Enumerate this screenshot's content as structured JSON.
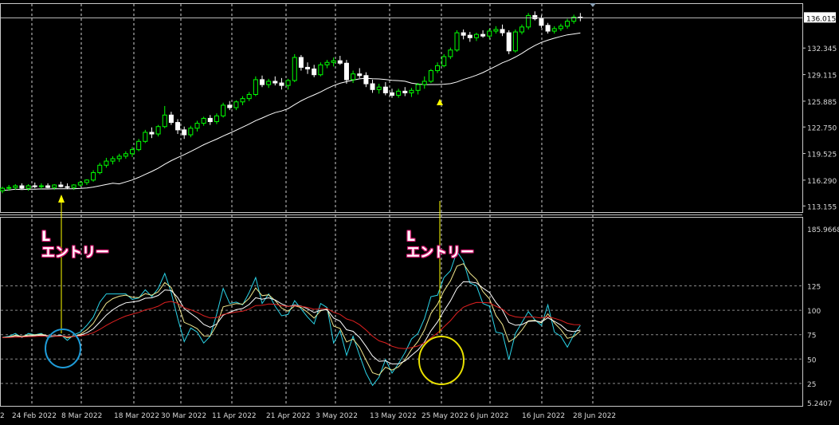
{
  "chart_data": {
    "type": "candlestick",
    "price_panel": {
      "y_ticks": [
        "132.345",
        "129.115",
        "125.885",
        "122.750",
        "119.525",
        "116.290",
        "113.155"
      ],
      "current_price_label": "136.015",
      "ylim": [
        112.6,
        137.6
      ],
      "candles": [
        [
          115.0,
          115.5,
          114.7,
          115.3
        ],
        [
          115.3,
          115.7,
          115.0,
          115.4
        ],
        [
          115.4,
          115.8,
          115.1,
          115.6
        ],
        [
          115.6,
          115.9,
          115.2,
          115.3
        ],
        [
          115.3,
          115.8,
          115.0,
          115.6
        ],
        [
          115.6,
          116.0,
          115.3,
          115.5
        ],
        [
          115.5,
          115.9,
          115.2,
          115.6
        ],
        [
          115.6,
          115.9,
          115.3,
          115.4
        ],
        [
          115.4,
          115.8,
          115.1,
          115.7
        ],
        [
          115.7,
          116.1,
          115.4,
          115.5
        ],
        [
          115.5,
          115.9,
          115.2,
          115.4
        ],
        [
          115.4,
          115.8,
          115.1,
          115.7
        ],
        [
          115.7,
          116.2,
          115.5,
          116.0
        ],
        [
          116.0,
          116.4,
          115.7,
          116.3
        ],
        [
          116.3,
          117.5,
          116.1,
          117.2
        ],
        [
          117.2,
          118.4,
          117.0,
          118.1
        ],
        [
          118.1,
          119.0,
          117.8,
          118.6
        ],
        [
          118.6,
          119.2,
          118.2,
          118.9
        ],
        [
          118.9,
          119.5,
          118.5,
          119.2
        ],
        [
          119.2,
          119.8,
          118.9,
          119.5
        ],
        [
          119.5,
          120.3,
          119.1,
          120.0
        ],
        [
          120.0,
          121.3,
          119.8,
          121.0
        ],
        [
          121.0,
          122.4,
          120.8,
          122.1
        ],
        [
          122.1,
          122.7,
          121.4,
          121.9
        ],
        [
          121.9,
          123.0,
          121.6,
          122.8
        ],
        [
          122.8,
          125.3,
          122.6,
          124.2
        ],
        [
          124.2,
          124.6,
          123.0,
          123.3
        ],
        [
          123.3,
          123.7,
          121.9,
          122.4
        ],
        [
          122.4,
          122.8,
          121.3,
          121.8
        ],
        [
          121.8,
          122.9,
          121.5,
          122.6
        ],
        [
          122.6,
          123.5,
          122.2,
          123.2
        ],
        [
          123.2,
          124.0,
          122.9,
          123.8
        ],
        [
          123.8,
          124.2,
          123.0,
          123.4
        ],
        [
          123.4,
          124.4,
          123.1,
          124.1
        ],
        [
          124.1,
          125.7,
          123.9,
          125.4
        ],
        [
          125.4,
          125.9,
          124.8,
          125.1
        ],
        [
          125.1,
          126.0,
          124.8,
          125.8
        ],
        [
          125.8,
          126.5,
          125.4,
          126.2
        ],
        [
          126.2,
          127.0,
          125.9,
          126.7
        ],
        [
          126.7,
          128.9,
          126.5,
          128.5
        ],
        [
          128.5,
          129.0,
          127.6,
          127.9
        ],
        [
          127.9,
          128.6,
          127.5,
          128.3
        ],
        [
          128.3,
          128.9,
          127.8,
          128.1
        ],
        [
          128.1,
          128.7,
          127.3,
          127.8
        ],
        [
          127.8,
          128.6,
          127.3,
          128.4
        ],
        [
          128.4,
          131.6,
          128.2,
          131.2
        ],
        [
          131.2,
          131.5,
          129.6,
          130.0
        ],
        [
          130.0,
          130.6,
          129.2,
          129.8
        ],
        [
          129.8,
          130.3,
          128.8,
          129.1
        ],
        [
          129.1,
          130.6,
          128.9,
          130.3
        ],
        [
          130.3,
          130.9,
          129.9,
          130.6
        ],
        [
          130.6,
          131.2,
          130.1,
          130.8
        ],
        [
          130.8,
          131.4,
          130.3,
          130.5
        ],
        [
          130.5,
          130.9,
          128.0,
          128.5
        ],
        [
          128.5,
          129.6,
          128.1,
          129.2
        ],
        [
          129.2,
          129.9,
          128.7,
          129.0
        ],
        [
          129.0,
          129.4,
          127.6,
          128.0
        ],
        [
          128.0,
          128.5,
          126.9,
          127.3
        ],
        [
          127.3,
          128.0,
          126.8,
          127.6
        ],
        [
          127.6,
          128.2,
          126.6,
          126.9
        ],
        [
          126.9,
          127.4,
          126.3,
          126.6
        ],
        [
          126.6,
          127.4,
          126.3,
          127.1
        ],
        [
          127.1,
          127.6,
          126.5,
          126.9
        ],
        [
          126.9,
          127.5,
          126.4,
          127.2
        ],
        [
          127.2,
          128.1,
          126.7,
          127.9
        ],
        [
          127.9,
          128.9,
          127.4,
          128.3
        ],
        [
          128.3,
          129.8,
          128.1,
          129.6
        ],
        [
          129.6,
          130.6,
          129.3,
          130.2
        ],
        [
          130.2,
          131.6,
          130.0,
          131.3
        ],
        [
          131.3,
          132.4,
          131.0,
          132.1
        ],
        [
          132.1,
          134.5,
          131.9,
          134.2
        ],
        [
          134.2,
          134.6,
          133.4,
          133.9
        ],
        [
          133.9,
          134.3,
          133.1,
          133.6
        ],
        [
          133.6,
          134.2,
          133.2,
          134.0
        ],
        [
          134.0,
          134.5,
          133.6,
          133.8
        ],
        [
          133.8,
          134.7,
          133.5,
          134.4
        ],
        [
          134.4,
          135.0,
          134.1,
          134.6
        ],
        [
          134.6,
          135.2,
          133.8,
          134.2
        ],
        [
          134.2,
          134.5,
          131.6,
          132.0
        ],
        [
          132.0,
          134.6,
          131.8,
          134.3
        ],
        [
          134.3,
          135.2,
          134.0,
          134.9
        ],
        [
          134.9,
          136.6,
          134.6,
          136.3
        ],
        [
          136.3,
          136.8,
          135.7,
          135.9
        ],
        [
          135.9,
          136.3,
          134.8,
          135.1
        ],
        [
          135.1,
          135.4,
          134.1,
          134.4
        ],
        [
          134.4,
          135.0,
          134.1,
          134.7
        ],
        [
          134.7,
          135.3,
          134.4,
          135.0
        ],
        [
          135.0,
          135.9,
          134.7,
          135.6
        ],
        [
          135.6,
          136.4,
          135.3,
          136.1
        ],
        [
          136.1,
          136.6,
          135.6,
          136.0
        ]
      ]
    },
    "oscillator_panel": {
      "y_ticks": [
        "185.9668",
        "125",
        "100",
        "75",
        "50",
        "25",
        "5.2407"
      ],
      "gridlines": [
        125,
        100,
        75,
        50,
        25
      ],
      "ylim": [
        5.2407,
        185.9668
      ]
    },
    "x_labels": [
      "24 Feb 2022",
      "8 Mar 2022",
      "18 Mar 2022",
      "30 Mar 2022",
      "11 Apr 2022",
      "21 Apr 2022",
      "3 May 2022",
      "13 May 2022",
      "25 May 2022",
      "6 Jun 2022",
      "16 Jun 2022",
      "28 Jun 2022"
    ],
    "x_label_leading": "2",
    "annotations": [
      {
        "line1": "L",
        "line2": "エントリー"
      },
      {
        "line1": "L",
        "line2": "エントリー"
      }
    ],
    "colors": {
      "background": "#000000",
      "bull_candle": "#00ff00",
      "bear_candle": "#ffffff",
      "ma_line": "#ffffff",
      "arrow": "#ffff00",
      "osc_fast": "#2ad4e8",
      "osc_mid": "#f0e68c",
      "osc_slow": "#ffffff",
      "osc_signal": "#e02020",
      "circle1": "#1e9bd7",
      "circle2": "#e8e000",
      "text_accent": "#e0207a"
    }
  }
}
